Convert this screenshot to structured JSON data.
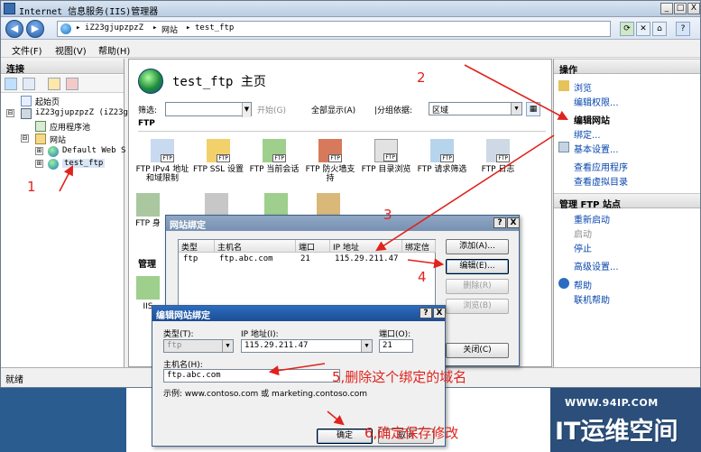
{
  "window": {
    "title": "Internet 信息服务(IIS)管理器",
    "controls": [
      "_",
      "□",
      "X"
    ]
  },
  "address": {
    "breadcrumbs": [
      "iZ23gjupzpzZ",
      "网站",
      "test_ftp"
    ],
    "separator": "▸",
    "tool_icons": [
      "refresh-icon",
      "stop-icon",
      "home-icon",
      "help-icon"
    ]
  },
  "menu": [
    "文件(F)",
    "视图(V)",
    "帮助(H)"
  ],
  "connections": {
    "header": "连接",
    "tree": [
      {
        "label": "起始页",
        "icon": "start-page-icon"
      },
      {
        "label": "iZ23gjupzpzZ (iZ23gj",
        "icon": "server-icon",
        "expander": "⊟"
      },
      {
        "label": "应用程序池",
        "icon": "app-pool-icon"
      },
      {
        "label": "网站",
        "icon": "sites-folder-icon",
        "expander": "⊟"
      },
      {
        "label": "Default Web S",
        "icon": "globe-icon",
        "expander": "⊞"
      },
      {
        "label": "test_ftp",
        "icon": "globe-icon",
        "expander": "⊞"
      }
    ]
  },
  "center": {
    "heading": "test_ftp 主页",
    "filter_label": "筛选:",
    "filter_value": "",
    "start_label": "开始(G)",
    "show_all_label": "全部显示(A)",
    "group_by_label": "|分组依据:",
    "group_by_value": "区域",
    "section_ftp": "FTP",
    "features": [
      {
        "label": "FTP IPv4 地址和域限制",
        "icon": "ipv4-restrict-icon"
      },
      {
        "label": "FTP SSL 设置",
        "icon": "ssl-lock-icon"
      },
      {
        "label": "FTP 当前会话",
        "icon": "sessions-icon"
      },
      {
        "label": "FTP 防火墙支持",
        "icon": "firewall-icon"
      },
      {
        "label": "FTP 目录浏览",
        "icon": "directory-browse-icon"
      },
      {
        "label": "FTP 请求筛选",
        "icon": "request-filter-icon"
      },
      {
        "label": "FTP 日志",
        "icon": "log-icon"
      }
    ],
    "features_row2_partial": [
      "FTP 身",
      "",
      "",
      ""
    ],
    "section_mgmt": "管理",
    "mgmt_partial": "IIS"
  },
  "actions": {
    "header": "操作",
    "top_links": [
      {
        "label": "浏览",
        "style": "link",
        "icon": "browse-icon"
      },
      {
        "label": "编辑权限...",
        "style": "link"
      },
      {
        "label": "编辑网站",
        "style": "bold"
      },
      {
        "label": "绑定...",
        "style": "link"
      },
      {
        "label": "基本设置...",
        "style": "link",
        "icon": "settings-icon"
      },
      {
        "label": "查看应用程序",
        "style": "link"
      },
      {
        "label": "查看虚拟目录",
        "style": "link"
      }
    ],
    "manage_header": "管理 FTP 站点",
    "manage_links": [
      {
        "label": "重新启动",
        "style": "link"
      },
      {
        "label": "启动",
        "style": "disabled"
      },
      {
        "label": "停止",
        "style": "link"
      },
      {
        "label": "高级设置...",
        "style": "link"
      },
      {
        "label": "帮助",
        "style": "link",
        "icon": "help-icon"
      },
      {
        "label": "联机帮助",
        "style": "link"
      }
    ]
  },
  "status": {
    "text": "就绪"
  },
  "site_bindings": {
    "title": "网站绑定",
    "help_btn": "?",
    "close_btn": "X",
    "columns": [
      "类型",
      "主机名",
      "端口",
      "IP 地址",
      "绑定信"
    ],
    "rows": [
      [
        "ftp",
        "ftp.abc.com",
        "21",
        "115.29.211.47",
        ""
      ]
    ],
    "buttons": {
      "add": "添加(A)...",
      "edit": "编辑(E)...",
      "remove": "删除(R)",
      "browse": "浏览(B)",
      "close": "关闭(C)"
    }
  },
  "edit_binding": {
    "title": "编辑网站绑定",
    "help_btn": "?",
    "close_btn": "X",
    "type_label": "类型(T):",
    "type_value": "ftp",
    "ip_label": "IP 地址(I):",
    "ip_value": "115.29.211.47",
    "port_label": "端口(O):",
    "port_value": "21",
    "host_label": "主机名(H):",
    "host_value": "ftp.abc.com",
    "example": "示例: www.contoso.com 或 marketing.contoso.com",
    "ok": "确定",
    "cancel": "取消"
  },
  "annotations": [
    "1",
    "2",
    "3",
    "4",
    "5,删除这个绑定的域名",
    "6,确定保存修改"
  ],
  "watermark": {
    "url": "WWW.94IP.COM",
    "logo": "IT运维空间"
  },
  "colors": {
    "annotation": "#e0231c",
    "link": "#0645ad",
    "dialog_title": "#1b4d94"
  }
}
